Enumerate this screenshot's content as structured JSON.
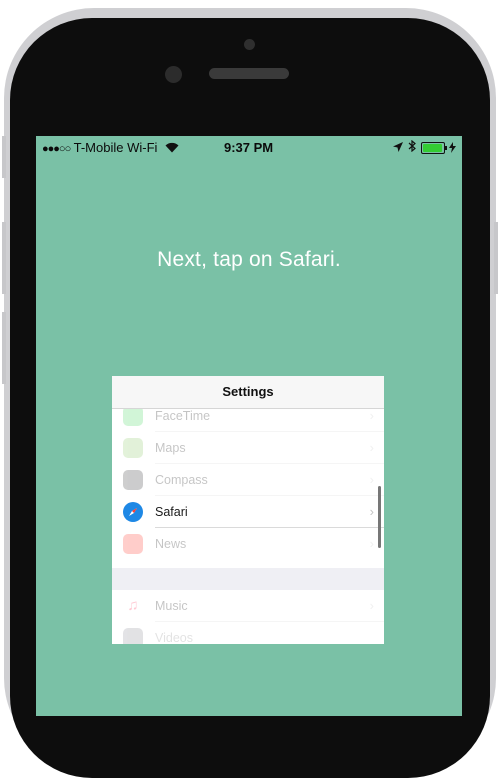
{
  "status_bar": {
    "signal": "●●●○○",
    "carrier": "T-Mobile Wi-Fi",
    "time": "9:37 PM"
  },
  "instruction": "Next, tap on Safari.",
  "settings": {
    "title": "Settings",
    "items": [
      {
        "label": "FaceTime",
        "icon": "facetime-icon",
        "color": "#4cd964"
      },
      {
        "label": "Maps",
        "icon": "maps-icon",
        "color": "#8fcb6b"
      },
      {
        "label": "Compass",
        "icon": "compass-icon",
        "color": "#3a3a3c"
      },
      {
        "label": "Safari",
        "icon": "safari-icon",
        "color": "#1e88e5"
      },
      {
        "label": "News",
        "icon": "news-icon",
        "color": "#ff3b30"
      },
      {
        "label": "Music",
        "icon": "music-icon",
        "color": "#ff2d55"
      },
      {
        "label": "Videos",
        "icon": "videos-icon",
        "color": "#1a1a2e"
      }
    ]
  },
  "colors": {
    "screen_background": "#7ac1a6",
    "battery_fill": "#33cc33"
  }
}
